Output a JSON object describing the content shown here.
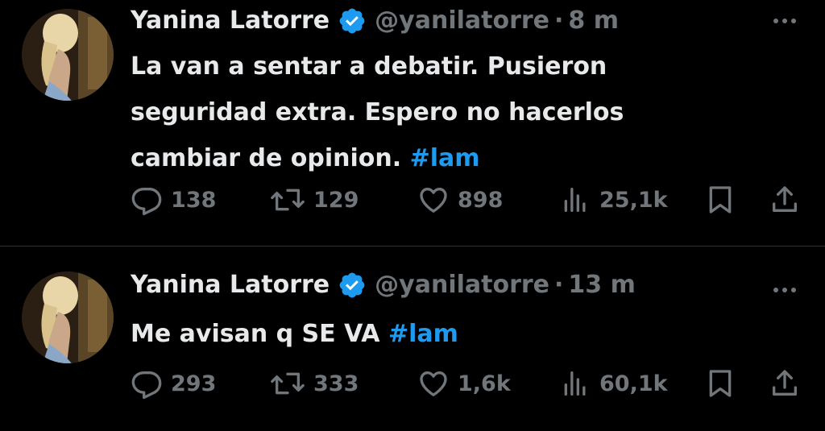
{
  "tweets": [
    {
      "display_name": "Yanina Latorre",
      "handle": "@yanilatorre",
      "separator": "·",
      "time": "8 m",
      "text_lines": [
        "La van a sentar a debatir. Pusieron",
        "seguridad extra. Espero no hacerlos",
        "cambiar de opinion."
      ],
      "hashtag": "#lam",
      "replies": "138",
      "retweets": "129",
      "likes": "898",
      "views": "25,1k"
    },
    {
      "display_name": "Yanina Latorre",
      "handle": "@yanilatorre",
      "separator": "·",
      "time": "13 m",
      "text_lines": [
        "Me avisan q SE VA"
      ],
      "hashtag": "#lam",
      "replies": "293",
      "retweets": "333",
      "likes": "1,6k",
      "views": "60,1k"
    }
  ],
  "icons": {
    "verified": "verified-badge-icon",
    "more": "more-options-icon",
    "reply": "reply-icon",
    "retweet": "retweet-icon",
    "like": "heart-icon",
    "views": "views-icon",
    "bookmark": "bookmark-icon",
    "share": "share-icon"
  },
  "colors": {
    "background": "#000000",
    "text": "#e7e9ea",
    "muted": "#71767b",
    "accent": "#1d9bf0",
    "divider": "#2f3336"
  }
}
